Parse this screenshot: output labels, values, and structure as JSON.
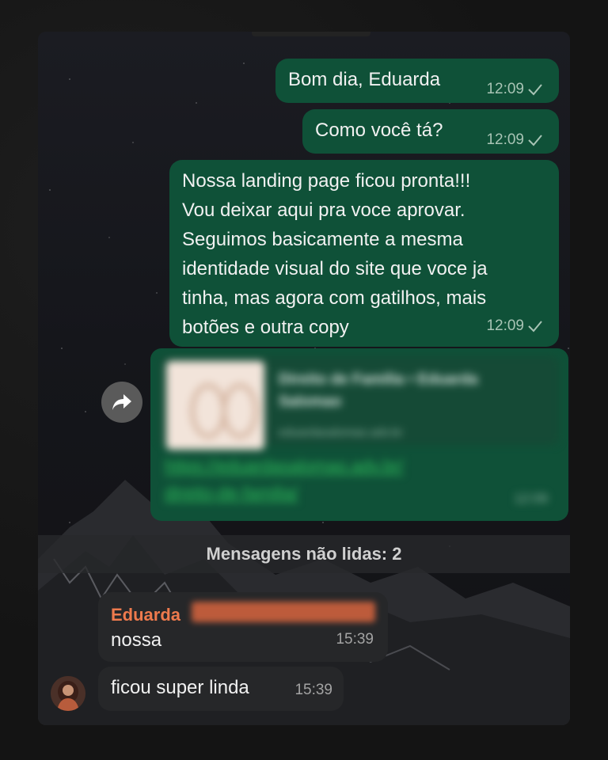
{
  "messages_out": [
    {
      "text": "Bom dia, Eduarda",
      "time": "12:09"
    },
    {
      "text": "Como você tá?",
      "time": "12:09"
    },
    {
      "text_lines": [
        "Nossa landing page ficou pronta!!!",
        "Vou deixar aqui pra voce aprovar.",
        "Seguimos basicamente a mesma",
        "identidade visual do site que voce ja",
        "tinha, mas agora com gatilhos, mais",
        "botões e outra copy"
      ],
      "time": "12:09"
    }
  ],
  "link_message": {
    "preview_title": "Direito de Família • Eduarda Salomao",
    "preview_domain": "eduardasalomao.adv.br",
    "url_lines": [
      "https://eduardasalomao.adv.br/",
      "direito-de-familia/"
    ],
    "time": "12:09"
  },
  "unread_divider": "Mensagens não lidas: 2",
  "messages_in": {
    "sender": "Eduarda",
    "sender_detail": "Salomao Advocacia",
    "items": [
      {
        "text": "nossa",
        "time": "15:39"
      },
      {
        "text": "ficou super linda",
        "time": "15:39"
      }
    ]
  },
  "icons": {
    "forward": "forward-arrow-icon",
    "read_status": "single-check-icon",
    "avatar": "contact-avatar"
  },
  "colors": {
    "outgoing_bubble": "#0f5138",
    "incoming_bubble": "#262729",
    "sender_name": "#ee7a4d",
    "link": "#2fbf5b"
  }
}
